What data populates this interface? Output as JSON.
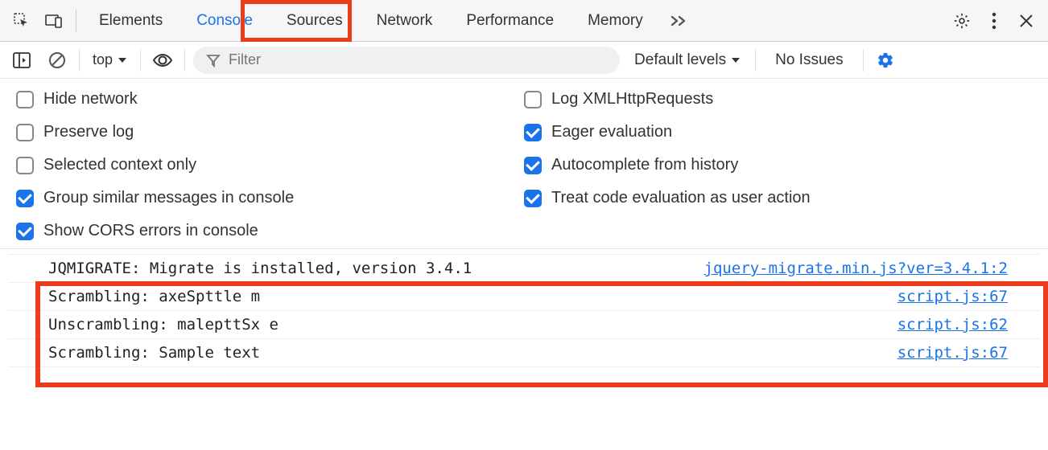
{
  "tabs": {
    "elements": "Elements",
    "console": "Console",
    "sources": "Sources",
    "network": "Network",
    "performance": "Performance",
    "memory": "Memory"
  },
  "toolbar": {
    "context": "top",
    "filter_placeholder": "Filter",
    "levels": "Default levels",
    "issues": "No Issues"
  },
  "settings": {
    "left": [
      {
        "label": "Hide network",
        "checked": false
      },
      {
        "label": "Preserve log",
        "checked": false
      },
      {
        "label": "Selected context only",
        "checked": false
      },
      {
        "label": "Group similar messages in console",
        "checked": true
      },
      {
        "label": "Show CORS errors in console",
        "checked": true
      }
    ],
    "right": [
      {
        "label": "Log XMLHttpRequests",
        "checked": false
      },
      {
        "label": "Eager evaluation",
        "checked": true
      },
      {
        "label": "Autocomplete from history",
        "checked": true
      },
      {
        "label": "Treat code evaluation as user action",
        "checked": true
      }
    ]
  },
  "logs": [
    {
      "msg": "JQMIGRATE: Migrate is installed, version 3.4.1",
      "src": "jquery-migrate.min.js?ver=3.4.1:2"
    },
    {
      "msg": "Scrambling: axeSpttle m",
      "src": "script.js:67"
    },
    {
      "msg": "Unscrambling: malepttSx e",
      "src": "script.js:62"
    },
    {
      "msg": "Scrambling: Sample text",
      "src": "script.js:67"
    }
  ]
}
